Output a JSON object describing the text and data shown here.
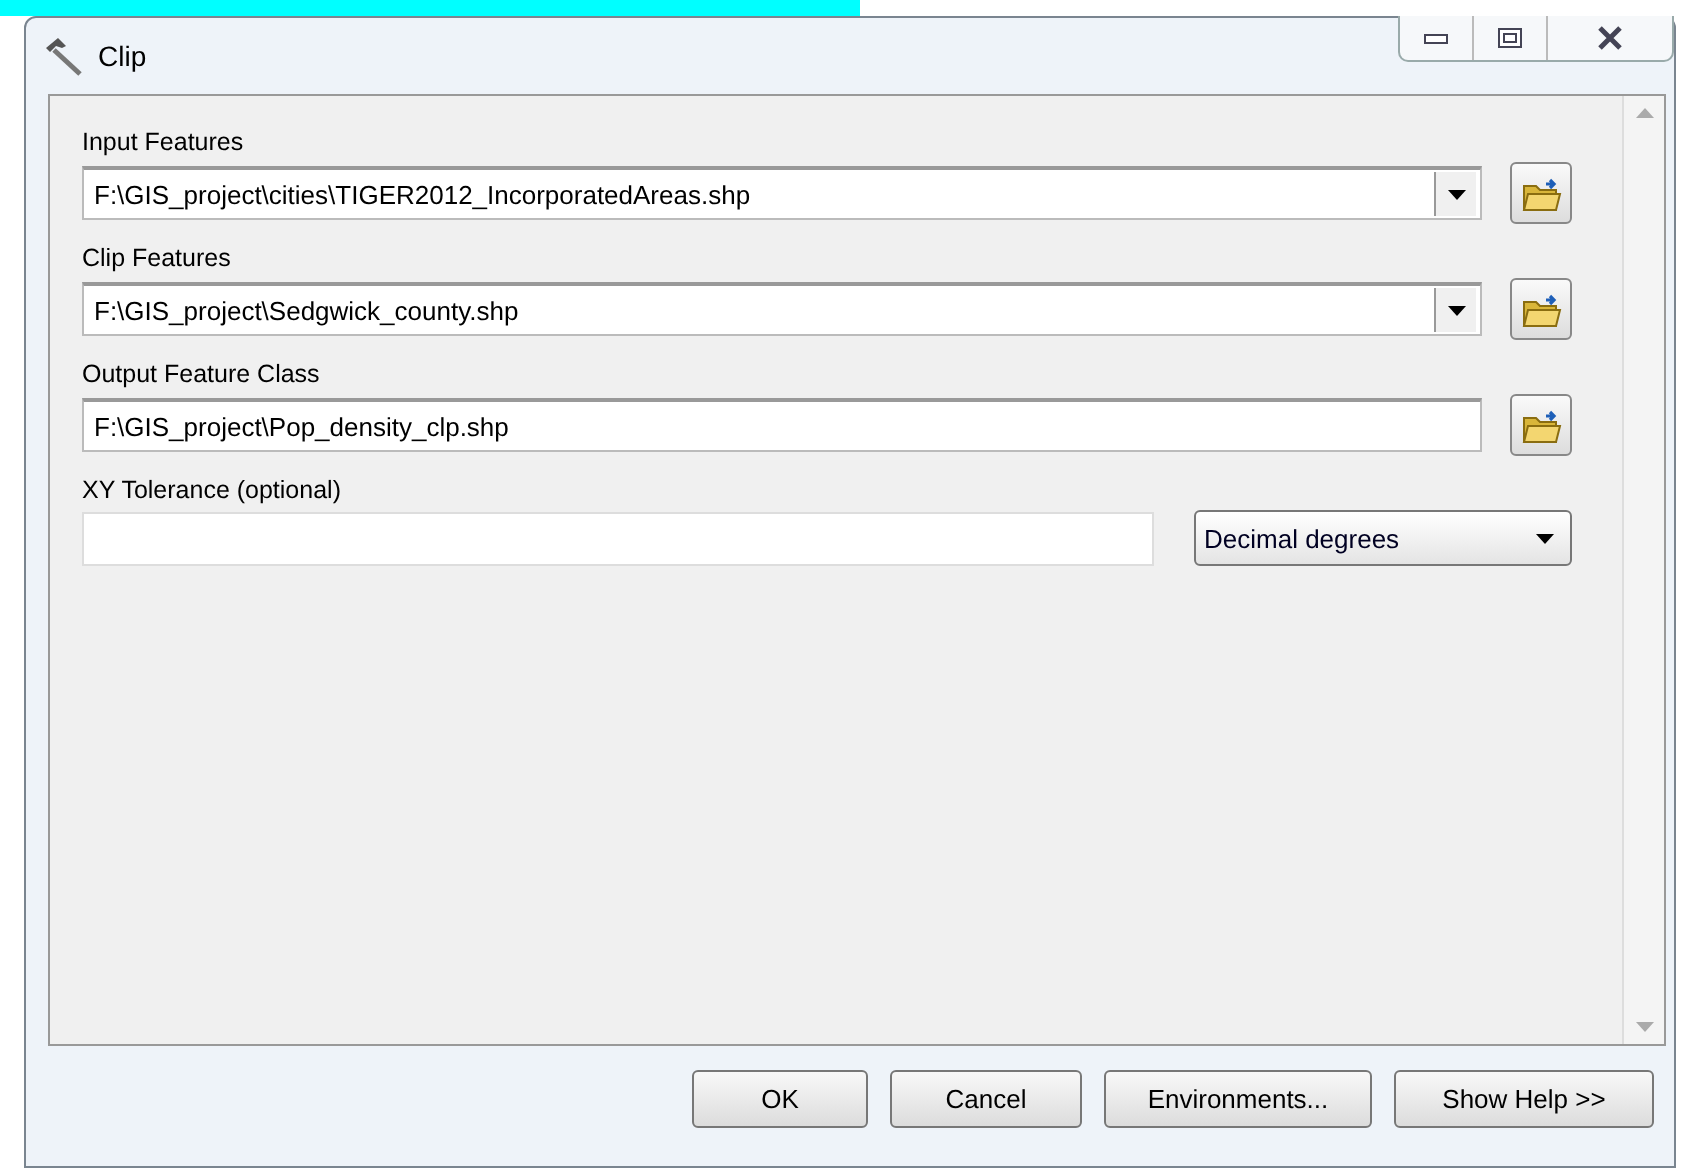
{
  "window": {
    "title": "Clip"
  },
  "parameters": [
    {
      "kind": "combo",
      "label": "Input Features",
      "value": "F:\\GIS_project\\cities\\TIGER2012_IncorporatedAreas.shp"
    },
    {
      "kind": "combo",
      "label": "Clip Features",
      "value": "F:\\GIS_project\\Sedgwick_county.shp"
    },
    {
      "kind": "path",
      "label": "Output Feature Class",
      "value": "F:\\GIS_project\\Pop_density_clp.shp"
    },
    {
      "kind": "unit",
      "label": "XY Tolerance (optional)",
      "unit": "Decimal degrees"
    }
  ],
  "buttons": [
    "OK",
    "Cancel",
    "Environments...",
    "Show Help >>"
  ]
}
